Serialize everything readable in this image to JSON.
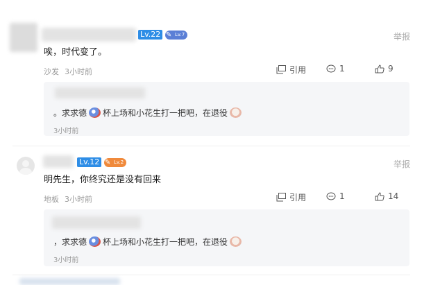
{
  "comments": [
    {
      "level_badge": "Lv.22",
      "medal_badge": "Lv.7",
      "report": "举报",
      "text": "唉，时代变了。",
      "floor": "沙发",
      "time": "3小时前",
      "quote_label": "引用",
      "reply_count": "1",
      "like_count": "9",
      "reply": {
        "text_before": "。求求德",
        "text_mid": "杯上场和小花生打一把吧，在退役",
        "time": "3小时前"
      }
    },
    {
      "level_badge": "Lv.12",
      "medal_badge": "Lv.2",
      "report": "举报",
      "text": "明先生，你终究还是没有回来",
      "floor": "地板",
      "time": "3小时前",
      "quote_label": "引用",
      "reply_count": "1",
      "like_count": "14",
      "reply": {
        "text_before": "，求求德",
        "text_mid": "杯上场和小花生打一把吧，在退役",
        "time": "3小时前"
      }
    }
  ],
  "colors": {
    "level_badge": "#2e8de6",
    "medal_blue": "#5b7fd6",
    "medal_orange": "#f08a3c",
    "reply_bg": "#f5f6f8",
    "meta_text": "#9a9a9a"
  },
  "icons": [
    "quote-icon",
    "comment-icon",
    "thumbs-up-icon",
    "emoji-sticker-icon",
    "avatar-placeholder-icon"
  ]
}
